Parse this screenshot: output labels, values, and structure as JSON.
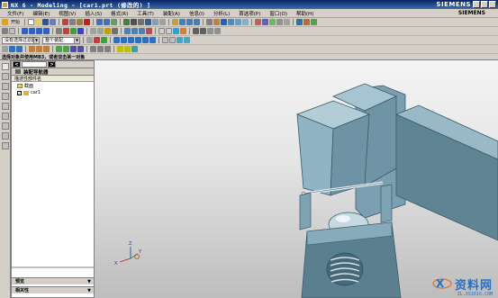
{
  "window": {
    "title": "NX 6 - Modeling - [car1.prt (修改的) ]",
    "brand": "SIEMENS"
  },
  "menu": [
    "文件(F)",
    "编辑(E)",
    "视图(V)",
    "插入(S)",
    "格式(R)",
    "工具(T)",
    "装配(A)",
    "信息(I)",
    "分析(L)",
    "首选项(P)",
    "窗口(O)",
    "帮助(H)"
  ],
  "menu_brand": "SIEMENS",
  "toolbar": {
    "start_label": "开始",
    "filter_combo": "没有选择过滤器",
    "assembly_combo": "整个装配"
  },
  "cue_line": "选择对象并使用MB3，或者双击某一对象",
  "navigator": {
    "tab_label": "装配导航器",
    "header": "装配导航器",
    "column_header": "描述性部件名",
    "tree": [
      {
        "label": "截面",
        "type": "folder"
      },
      {
        "label": "car1",
        "type": "part",
        "checked": true
      }
    ],
    "bottom_panels": [
      "预览",
      "相关性"
    ]
  },
  "triad": {
    "x": "X",
    "y": "Y",
    "z": "Z"
  },
  "watermark": {
    "main": "资料网",
    "sub": "ZL.XS1616.COM"
  },
  "colors": {
    "titlebar": "#0a246a",
    "model": "#8fb4c4",
    "model_dark": "#5f8595",
    "background_top": "#f4f4f4",
    "background_bottom": "#bdbdbd"
  }
}
